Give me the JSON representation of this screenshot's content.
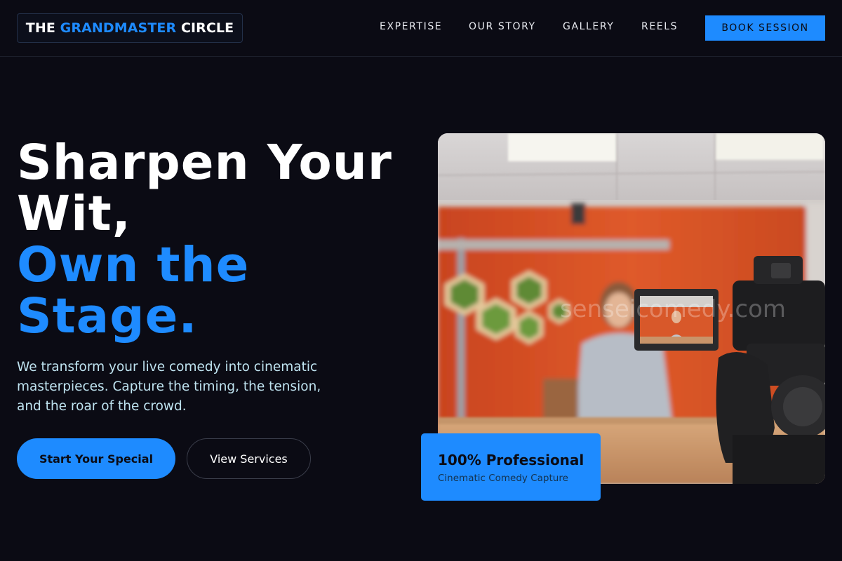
{
  "nav": {
    "logo": {
      "part1": "THE",
      "part2": "GRANDMASTER",
      "part3": "CIRCLE"
    },
    "links": [
      "EXPERTISE",
      "OUR STORY",
      "GALLERY",
      "REELS"
    ],
    "cta": "BOOK SESSION"
  },
  "hero": {
    "headline": [
      "Sharpen Your",
      "Wit,"
    ],
    "headline_accent": [
      "Own the",
      "Stage."
    ],
    "subtitle": "We transform your live comedy into cinematic masterpieces. Capture the timing, the tension, and the roar of the crowd.",
    "primary_button": "Start Your Special",
    "secondary_button": "View Services",
    "image": {
      "alt": "Camera on tripod filming a woman presenting in front of an orange wall with hexagon moss panels",
      "watermark": "senseicomedy.com"
    },
    "badge": {
      "title": "100% Professional",
      "subtitle": "Cinematic Comedy Capture"
    }
  },
  "colors": {
    "background": "#0b0b14",
    "accent": "#1e8bff",
    "subtitle_text": "#bfe3f0"
  }
}
